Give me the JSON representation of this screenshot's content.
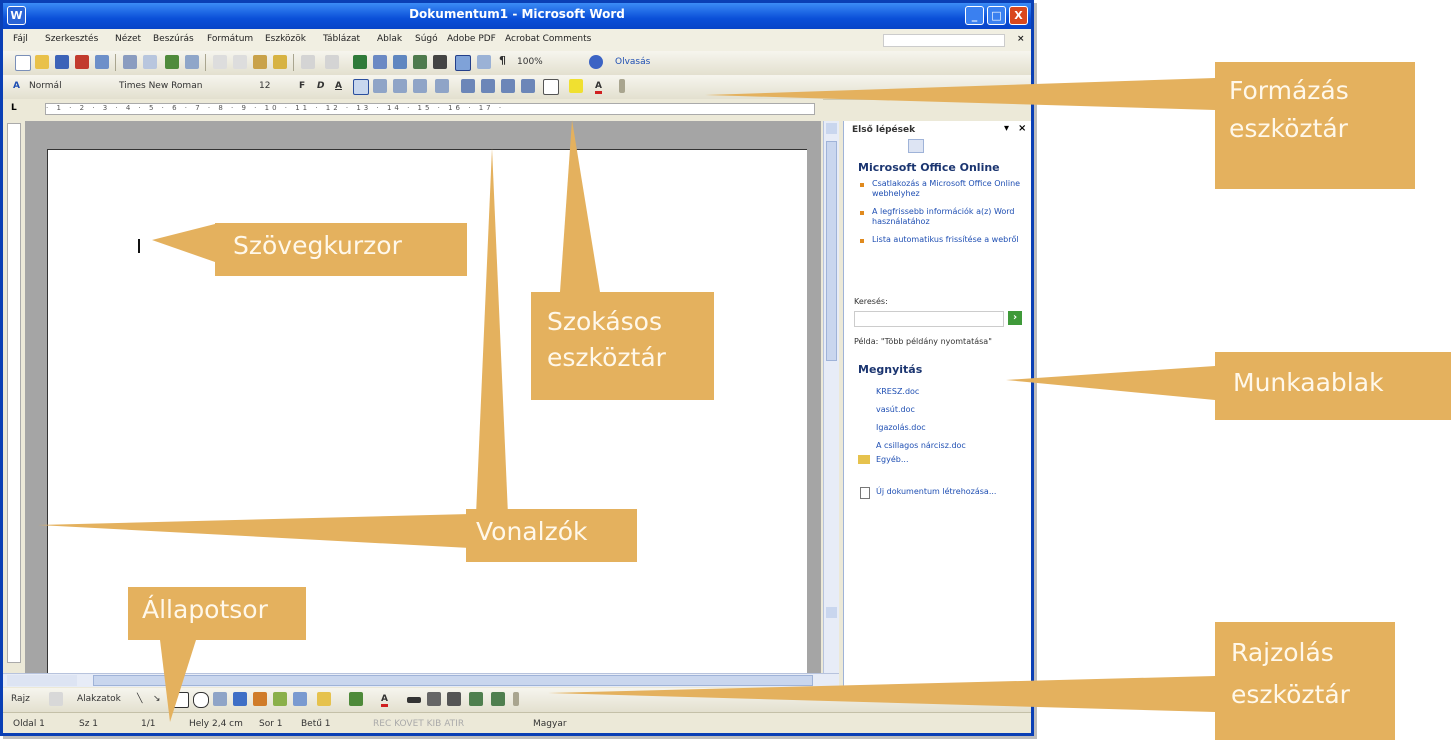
{
  "window": {
    "title": "Dokumentum1 - Microsoft Word",
    "close_glyph": "X"
  },
  "menu": [
    "Fájl",
    "Szerkesztés",
    "Nézet",
    "Beszúrás",
    "Formátum",
    "Eszközök",
    "Táblázat",
    "Ablak",
    "Súgó",
    "Adobe PDF",
    "Acrobat Comments"
  ],
  "menu_close": "×",
  "standard_toolbar": {
    "zoom": "100%",
    "reading": "Olvasás"
  },
  "formatting_toolbar": {
    "style": "Normál",
    "font": "Times New Roman",
    "size": "12",
    "bold": "F",
    "italic": "D",
    "underline": "A"
  },
  "task_pane": {
    "title": "Első lépések",
    "online_heading": "Microsoft Office Online",
    "links": [
      "Csatlakozás a Microsoft Office Online webhelyhez",
      "A legfrissebb információk a(z) Word használatához",
      "Lista automatikus frissítése a webről"
    ],
    "search_label": "Keresés:",
    "example": "Példa: \"Több példány nyomtatása\"",
    "open_heading": "Megnyitás",
    "files": [
      "KRESZ.doc",
      "vasút.doc",
      "Igazolás.doc",
      "A csillagos nárcisz.doc"
    ],
    "more": "Egyéb...",
    "new_document": "Új dokumentum létrehozása..."
  },
  "drawing_toolbar": {
    "draw": "Rajz",
    "autoshapes": "Alakzatok"
  },
  "status_bar": {
    "page": "Oldal 1",
    "section": "Sz 1",
    "page_of": "1/1",
    "position": "Hely 2,4 cm",
    "line": "Sor 1",
    "column": "Betű 1",
    "modes": "REC KOVET KIB ATIR",
    "language": "Magyar"
  },
  "callouts": {
    "formatting": [
      "Formázás",
      "eszköztár"
    ],
    "cursor": "Szövegkurzor",
    "standard": [
      "Szokásos",
      "eszköztár"
    ],
    "taskpane": "Munkaablak",
    "rulers": "Vonalzók",
    "statusbar": "Állapotsor",
    "drawing": [
      "Rajzolás",
      "eszköztár"
    ]
  },
  "colors": {
    "callout_fill": "#e4b15e",
    "title_blue": "#0a4fd8",
    "link_blue": "#1f4fb3",
    "heading_blue": "#1b3570"
  }
}
